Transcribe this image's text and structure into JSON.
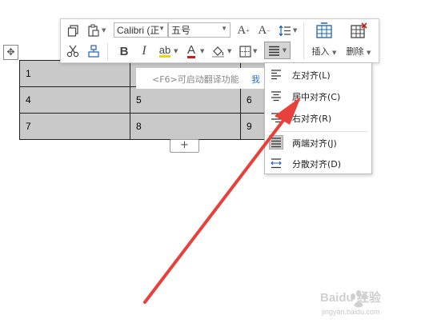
{
  "toolbar": {
    "font_name": "Calibri (正",
    "font_size": "五号",
    "insert_label": "插入",
    "delete_label": "删除"
  },
  "table": {
    "rows": [
      [
        "1",
        "",
        ""
      ],
      [
        "4",
        "5",
        "6"
      ],
      [
        "7",
        "8",
        "9"
      ]
    ]
  },
  "hint": {
    "text": "<F6>可启动翻译功能",
    "link": "我"
  },
  "align_menu": {
    "items": [
      {
        "label": "左对齐(L)"
      },
      {
        "label": "居中对齐(C)"
      },
      {
        "label": "右对齐(R)"
      },
      {
        "label": "两端对齐(J)"
      },
      {
        "label": "分散对齐(D)"
      }
    ]
  },
  "add_row_symbol": "+",
  "watermark": {
    "brand": "Baidu 经验",
    "url": "jingyan.baidu.com"
  },
  "colors": {
    "arrow": "#e8403a",
    "table_fill": "#c9c9c9",
    "font_color_underline": "#d11b1b",
    "highlight_underline": "#f2d600"
  }
}
